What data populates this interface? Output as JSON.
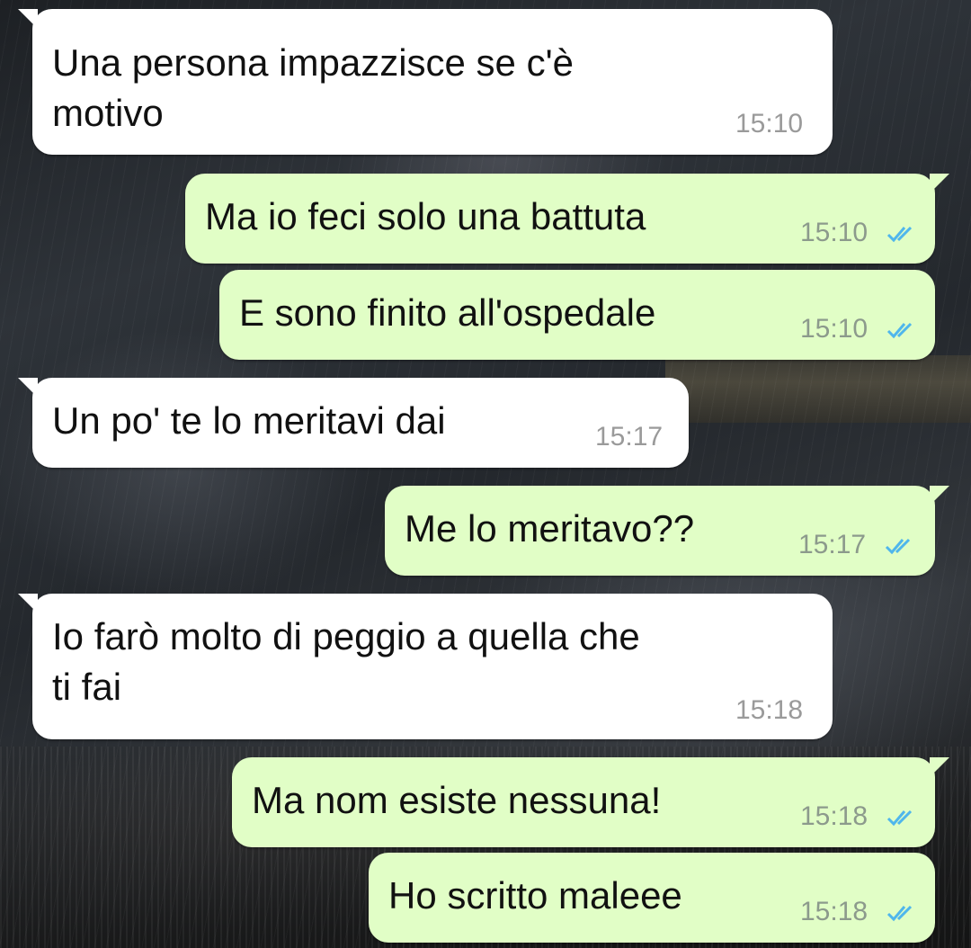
{
  "theme": {
    "incoming_bubble": "#ffffff",
    "outgoing_bubble": "#e1fec6",
    "read_ticks_color": "#4fb6ec",
    "read_ticks_icon": "double-check-icon"
  },
  "messages": [
    {
      "direction": "incoming",
      "text": "Una persona impazzisce se c'è\nmotivo",
      "time": "15:10"
    },
    {
      "direction": "outgoing",
      "text": "Ma io feci solo una battuta",
      "time": "15:10",
      "status": "read"
    },
    {
      "direction": "outgoing",
      "text": "E sono finito all'ospedale",
      "time": "15:10",
      "status": "read"
    },
    {
      "direction": "incoming",
      "text": "Un po' te lo meritavi dai",
      "time": "15:17"
    },
    {
      "direction": "outgoing",
      "text": "Me lo meritavo??",
      "time": "15:17",
      "status": "read"
    },
    {
      "direction": "incoming",
      "text": "Io farò molto di peggio a quella che\nti fai",
      "time": "15:18"
    },
    {
      "direction": "outgoing",
      "text": "Ma nom esiste nessuna!",
      "time": "15:18",
      "status": "read"
    },
    {
      "direction": "outgoing",
      "text": "Ho scritto maleee",
      "time": "15:18",
      "status": "read"
    }
  ]
}
